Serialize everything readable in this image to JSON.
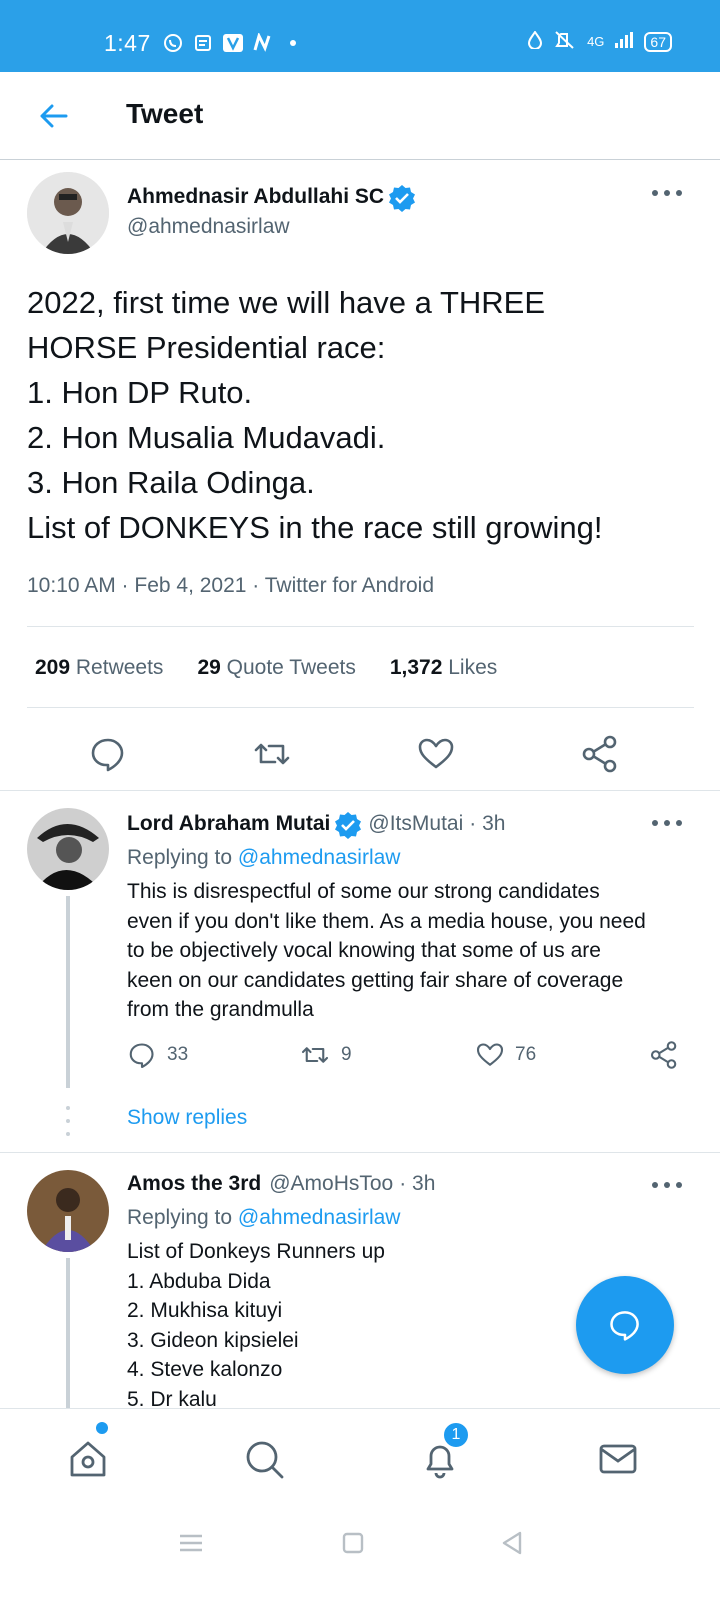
{
  "status_bar": {
    "time": "1:47",
    "battery": "67",
    "network": "4G"
  },
  "header": {
    "title": "Tweet"
  },
  "main_tweet": {
    "author_name": "Ahmednasir Abdullahi SC",
    "author_handle": "@ahmednasirlaw",
    "text": "2022, first time we will have a THREE\nHORSE Presidential race:\n1. Hon DP Ruto.\n2. Hon Musalia Mudavadi.\n3. Hon Raila Odinga.\nList of DONKEYS in the race still growing!",
    "meta": "10:10 AM · Feb 4, 2021 · Twitter for Android",
    "retweets_count": "209",
    "retweets_label": "Retweets",
    "quotes_count": "29",
    "quotes_label": "Quote Tweets",
    "likes_count": "1,372",
    "likes_label": "Likes"
  },
  "replies": [
    {
      "author_name": "Lord Abraham Mutai",
      "author_handle": "@ItsMutai",
      "time": "· 3h",
      "replying_prefix": "Replying to",
      "replying_to": "@ahmednasirlaw",
      "text": "This is disrespectful of some our strong candidates\neven if you don't like them. As a media house, you need\nto be objectively vocal knowing that some of us are\nkeen on our candidates getting fair share of coverage\nfrom the grandmulla",
      "reply_count": "33",
      "retweet_count": "9",
      "like_count": "76",
      "show_replies": "Show replies"
    },
    {
      "author_name": "Amos the 3rd",
      "author_handle": "@AmoHsToo",
      "time": "· 3h",
      "replying_prefix": "Replying to",
      "replying_to": "@ahmednasirlaw",
      "text": "List of Donkeys Runners up\n1. Abduba Dida\n2. Mukhisa kituyi\n3. Gideon kipsielei\n4. Steve kalonzo\n5. Dr kalu"
    }
  ],
  "bottom_nav": {
    "notifications_badge": "1"
  },
  "colors": {
    "accent": "#1d9bf0",
    "status_bar": "#2ba0e8",
    "secondary_text": "#536471"
  }
}
